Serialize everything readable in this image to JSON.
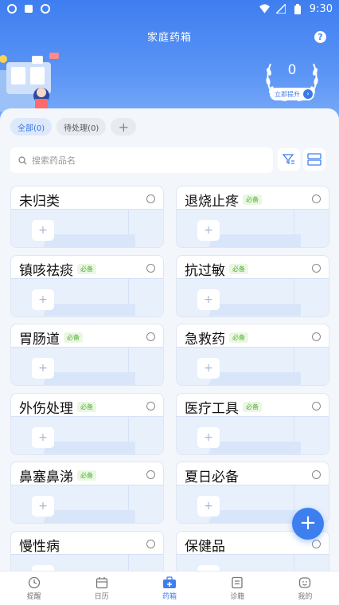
{
  "status_bar": {
    "time": "9:30",
    "left_icons": [
      "app-icon",
      "app-icon",
      "app-icon"
    ],
    "right_icons": [
      "wifi-icon",
      "signal-icon",
      "battery-icon"
    ]
  },
  "header": {
    "title": "家庭药箱",
    "help_label": "?",
    "score": "0",
    "promote_label": "立即提升"
  },
  "filters": [
    {
      "label": "全部(0)",
      "active": true
    },
    {
      "label": "待处理(0)",
      "active": false
    }
  ],
  "filter_add_label": "+",
  "search": {
    "placeholder": "搜索药品名"
  },
  "categories": [
    {
      "name": "未归类",
      "badge": ""
    },
    {
      "name": "退烧止疼",
      "badge": "必备"
    },
    {
      "name": "镇咳祛痰",
      "badge": "必备"
    },
    {
      "name": "抗过敏",
      "badge": "必备"
    },
    {
      "name": "胃肠道",
      "badge": "必备"
    },
    {
      "name": "急救药",
      "badge": "必备"
    },
    {
      "name": "外伤处理",
      "badge": "必备"
    },
    {
      "name": "医疗工具",
      "badge": "必备"
    },
    {
      "name": "鼻塞鼻涕",
      "badge": "必备"
    },
    {
      "name": "夏日必备",
      "badge": ""
    },
    {
      "name": "慢性病",
      "badge": ""
    },
    {
      "name": "保健品",
      "badge": ""
    }
  ],
  "card_add_label": "+",
  "fab_label": "+",
  "bottom_nav": [
    {
      "label": "提醒",
      "icon": "clock-icon",
      "active": false
    },
    {
      "label": "日历",
      "icon": "calendar-icon",
      "active": false
    },
    {
      "label": "药箱",
      "icon": "medkit-icon",
      "active": true
    },
    {
      "label": "诊籍",
      "icon": "record-icon",
      "active": false
    },
    {
      "label": "我的",
      "icon": "profile-icon",
      "active": false
    }
  ],
  "colors": {
    "primary": "#3e7ff0",
    "badge_green": "#57b33a"
  }
}
